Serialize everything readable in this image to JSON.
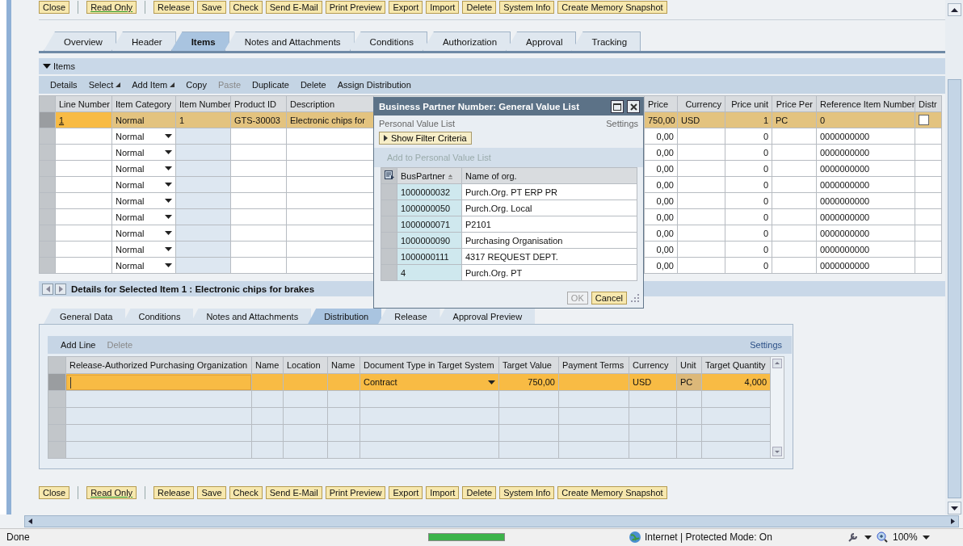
{
  "top_toolbar": [
    [
      {
        "label": "Close",
        "active": false
      }
    ],
    [
      {
        "label": "Read Only",
        "active": true
      }
    ],
    [
      {
        "label": "Release",
        "active": false
      },
      {
        "label": "Save",
        "active": false
      },
      {
        "label": "Check",
        "active": false
      },
      {
        "label": "Send E-Mail",
        "active": false
      },
      {
        "label": "Print Preview",
        "active": false
      },
      {
        "label": "Export",
        "active": false
      },
      {
        "label": "Import",
        "active": false
      },
      {
        "label": "Delete",
        "active": false
      },
      {
        "label": "System Info",
        "active": false
      },
      {
        "label": "Create Memory Snapshot",
        "active": false
      }
    ]
  ],
  "tabs": [
    {
      "label": "Overview",
      "selected": false
    },
    {
      "label": "Header",
      "selected": false
    },
    {
      "label": "Items",
      "selected": true
    },
    {
      "label": "Notes and Attachments",
      "selected": false
    },
    {
      "label": "Conditions",
      "selected": false
    },
    {
      "label": "Authorization",
      "selected": false
    },
    {
      "label": "Approval",
      "selected": false
    },
    {
      "label": "Tracking",
      "selected": false
    }
  ],
  "items_panel": {
    "title": "Items",
    "expanded": true,
    "toolbar": [
      {
        "label": "Details",
        "kind": "plain",
        "disabled": false
      },
      {
        "label": "Select",
        "kind": "menu",
        "disabled": false
      },
      {
        "label": "Add Item",
        "kind": "menu",
        "disabled": false
      },
      {
        "label": "Copy",
        "kind": "plain",
        "disabled": false
      },
      {
        "label": "Paste",
        "kind": "plain",
        "disabled": true
      },
      {
        "label": "Duplicate",
        "kind": "plain",
        "disabled": false
      },
      {
        "label": "Delete",
        "kind": "plain",
        "disabled": false
      },
      {
        "label": "Assign Distribution",
        "kind": "plain",
        "disabled": false
      }
    ],
    "columns": [
      "Line Number",
      "Item Category",
      "Item Number",
      "Product ID",
      "Description",
      "Price",
      "Currency",
      "Price unit",
      "Price Per",
      "Reference Item Number",
      "Distr"
    ],
    "rows": [
      {
        "kind": "item",
        "selected": true,
        "line_number": "1",
        "item_category": "Normal",
        "item_number": "1",
        "product_id": "GTS-30003",
        "description": "Electronic chips for",
        "price": "750,00",
        "currency": "USD",
        "price_unit": "1",
        "price_per": "PC",
        "reference_item_number": "0",
        "distributed": false
      },
      {
        "kind": "new",
        "selected": false,
        "item_category": "Normal",
        "price": "0,00",
        "price_unit": "0",
        "reference_item_number": "0000000000"
      },
      {
        "kind": "new",
        "selected": false,
        "item_category": "Normal",
        "price": "0,00",
        "price_unit": "0",
        "reference_item_number": "0000000000"
      },
      {
        "kind": "new",
        "selected": false,
        "item_category": "Normal",
        "price": "0,00",
        "price_unit": "0",
        "reference_item_number": "0000000000"
      },
      {
        "kind": "new",
        "selected": false,
        "item_category": "Normal",
        "price": "0,00",
        "price_unit": "0",
        "reference_item_number": "0000000000"
      },
      {
        "kind": "new",
        "selected": false,
        "item_category": "Normal",
        "price": "0,00",
        "price_unit": "0",
        "reference_item_number": "0000000000"
      },
      {
        "kind": "new",
        "selected": false,
        "item_category": "Normal",
        "price": "0,00",
        "price_unit": "0",
        "reference_item_number": "0000000000"
      },
      {
        "kind": "new",
        "selected": false,
        "item_category": "Normal",
        "price": "0,00",
        "price_unit": "0",
        "reference_item_number": "0000000000"
      },
      {
        "kind": "new",
        "selected": false,
        "item_category": "Normal",
        "price": "0,00",
        "price_unit": "0",
        "reference_item_number": "0000000000"
      },
      {
        "kind": "new",
        "selected": false,
        "item_category": "Normal",
        "price": "0,00",
        "price_unit": "0",
        "reference_item_number": "0000000000"
      }
    ]
  },
  "dialog": {
    "title": "Business Partner Number: General Value List",
    "personal_value_list": "Personal Value List",
    "settings": "Settings",
    "show_filter": "Show Filter Criteria",
    "add_to_list": "Add to Personal Value List",
    "columns": [
      "BusPartner",
      "Name of org."
    ],
    "rows": [
      {
        "bus_partner": "1000000032",
        "name": "Purch.Org. PT ERP PR"
      },
      {
        "bus_partner": "1000000050",
        "name": "Purch.Org. Local"
      },
      {
        "bus_partner": "1000000071",
        "name": "P2101"
      },
      {
        "bus_partner": "1000000090",
        "name": "Purchasing Organisation"
      },
      {
        "bus_partner": "1000000111",
        "name": "4317 REQUEST DEPT."
      },
      {
        "bus_partner": "4",
        "name": "Purch.Org. PT"
      }
    ],
    "buttons": [
      {
        "label": "OK",
        "disabled": true
      },
      {
        "label": "Cancel",
        "disabled": false
      }
    ]
  },
  "details_title": "Details for Selected Item 1 : Electronic chips for brakes",
  "detail_tabs": [
    {
      "label": "General Data",
      "selected": false
    },
    {
      "label": "Conditions",
      "selected": false
    },
    {
      "label": "Notes and Attachments",
      "selected": false
    },
    {
      "label": "Distribution",
      "selected": true
    },
    {
      "label": "Release",
      "selected": false
    },
    {
      "label": "Approval Preview",
      "selected": false
    }
  ],
  "distribution": {
    "toolbar": [
      {
        "label": "Add Line",
        "disabled": false
      },
      {
        "label": "Delete",
        "disabled": true
      }
    ],
    "settings": "Settings",
    "columns": [
      "Release-Authorized Purchasing Organization",
      "Name",
      "Location",
      "Name",
      "Document Type in Target System",
      "Target Value",
      "Payment Terms",
      "Currency",
      "Unit",
      "Target Quantity"
    ],
    "rows": [
      {
        "selected": true,
        "document_type": "Contract",
        "target_value": "750,00",
        "currency": "USD",
        "unit": "PC",
        "target_quantity": "4,000"
      },
      {
        "selected": false
      },
      {
        "selected": false
      },
      {
        "selected": false
      },
      {
        "selected": false
      }
    ]
  },
  "bottom_toolbar": [
    [
      {
        "label": "Close",
        "active": false
      }
    ],
    [
      {
        "label": "Read Only",
        "active": true
      }
    ],
    [
      {
        "label": "Release",
        "active": false
      },
      {
        "label": "Save",
        "active": false
      },
      {
        "label": "Check",
        "active": false
      },
      {
        "label": "Send E-Mail",
        "active": false
      },
      {
        "label": "Print Preview",
        "active": false
      },
      {
        "label": "Export",
        "active": false
      },
      {
        "label": "Import",
        "active": false
      },
      {
        "label": "Delete",
        "active": false
      },
      {
        "label": "System Info",
        "active": false
      },
      {
        "label": "Create Memory Snapshot",
        "active": false
      }
    ]
  ],
  "status_bar": {
    "text": "Done",
    "progress": {
      "level": 1
    },
    "zone": "Internet | Protected Mode: On",
    "zoom": "100%"
  }
}
